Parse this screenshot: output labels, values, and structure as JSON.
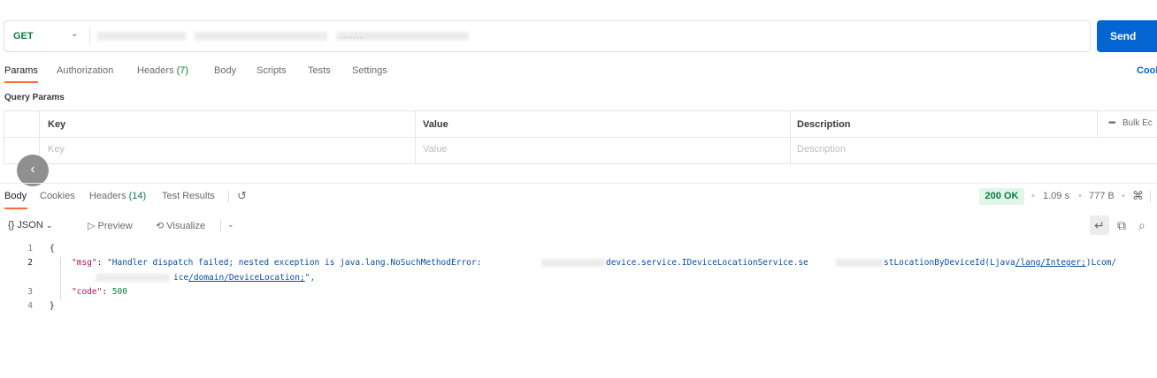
{
  "request": {
    "method": "GET",
    "url_visible_fragment": ".......",
    "send_label": "Send"
  },
  "request_tabs": {
    "params": "Params",
    "authorization": "Authorization",
    "headers": "Headers",
    "headers_count": "(7)",
    "body": "Body",
    "scripts": "Scripts",
    "tests": "Tests",
    "settings": "Settings",
    "cookies": "Cool"
  },
  "query_params": {
    "label": "Query Params",
    "columns": [
      "Key",
      "Value",
      "Description"
    ],
    "bulk_edit": "Bulk Ec",
    "placeholders": [
      "Key",
      "Value",
      "Description"
    ]
  },
  "response_tabs": {
    "body": "Body",
    "cookies": "Cookies",
    "headers": "Headers",
    "headers_count": "(14)",
    "test_results": "Test Results"
  },
  "response_meta": {
    "status": "200 OK",
    "time": "1.09 s",
    "size": "777 B"
  },
  "view_toolbar": {
    "format": "JSON",
    "preview": "Preview",
    "visualize": "Visualize"
  },
  "response_body": {
    "line_numbers": [
      "1",
      "2",
      "3",
      "4"
    ],
    "open_brace": "{",
    "close_brace": "}",
    "msg_key": "\"msg\"",
    "msg_part1": "\"Handler dispatch failed; nested exception is java.lang.NoSuchMethodError: ",
    "msg_part2": "device.service.IDeviceLocationService.se",
    "msg_part3": "stLocationByDeviceId(Ljava",
    "msg_link1": "/lang/Integer;",
    "msg_part4": ")Lcom/",
    "msg_cont_part1": "ice",
    "msg_link2": "/domain/DeviceLocation;",
    "msg_cont_end": "\",",
    "code_key": "\"code\"",
    "code_value": "500"
  },
  "colors": {
    "send_button": "#0265d2",
    "method_get": "#0a7c42",
    "active_tab_underline": "#ff6c37",
    "status_ok_bg": "#e1f5e8",
    "json_key": "#b0125b",
    "json_string": "#0b4ea2"
  },
  "icons": [
    "chevron-down-icon",
    "chevron-left-icon",
    "more-icon",
    "history-icon",
    "globe-icon",
    "preview-play-icon",
    "visualize-icon",
    "wrap-lines-icon",
    "copy-icon",
    "search-icon",
    "braces-icon"
  ]
}
